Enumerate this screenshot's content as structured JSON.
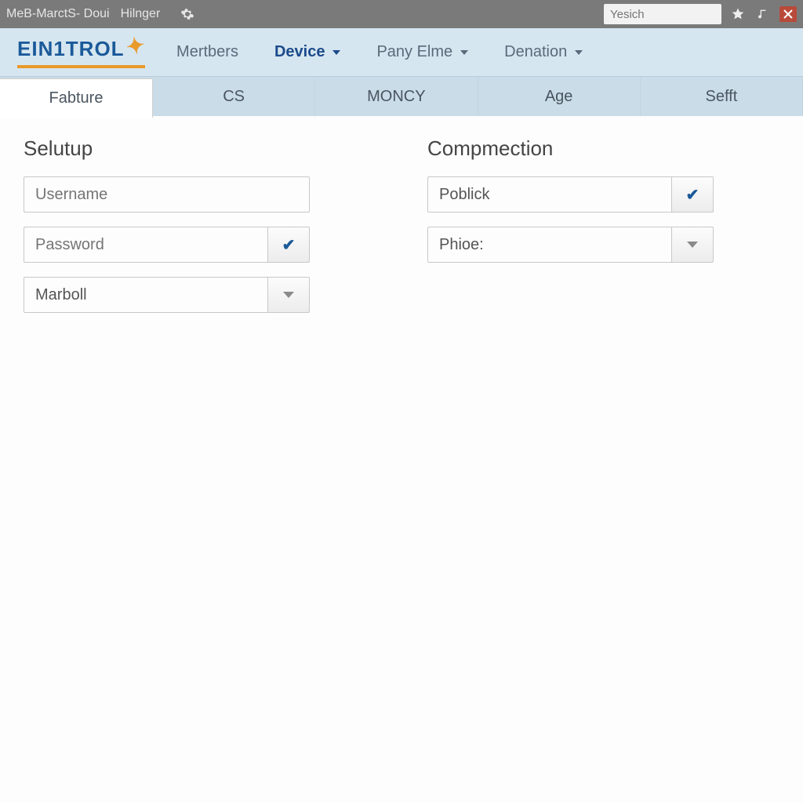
{
  "titlebar": {
    "app_title": "MeB-MarctS- Doui",
    "secondary": "Hilnger",
    "search_placeholder": "Yesich"
  },
  "logo": {
    "text": "EIN1TROL"
  },
  "nav": {
    "items": [
      {
        "label": "Mertbers",
        "active": false,
        "dropdown": false
      },
      {
        "label": "Device",
        "active": true,
        "dropdown": true
      },
      {
        "label": "Pany Elme",
        "active": false,
        "dropdown": true
      },
      {
        "label": "Denation",
        "active": false,
        "dropdown": true
      }
    ]
  },
  "tabs": {
    "items": [
      {
        "label": "Fabture",
        "active": true
      },
      {
        "label": "CS",
        "active": false
      },
      {
        "label": "MONCY",
        "active": false
      },
      {
        "label": "Age",
        "active": false
      },
      {
        "label": "Sefft",
        "active": false
      }
    ]
  },
  "left_section": {
    "title": "Selutup",
    "fields": {
      "username_placeholder": "Username",
      "password_placeholder": "Password",
      "marboll_value": "Marboll"
    }
  },
  "right_section": {
    "title": "Compmection",
    "fields": {
      "poblick_value": "Poblick",
      "phioe_value": "Phioe:"
    }
  },
  "colors": {
    "brand": "#1b5a99",
    "accent": "#e89a2a"
  }
}
